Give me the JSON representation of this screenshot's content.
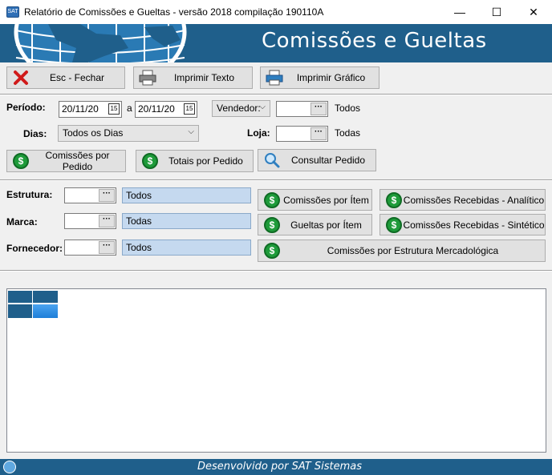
{
  "window": {
    "title": "Relatório de Comissões e Gueltas - versão 2018 compilação 190110A",
    "minimize": "—",
    "maximize": "☐",
    "close": "✕"
  },
  "banner": {
    "title": "Comissões e Gueltas"
  },
  "toolbar": {
    "close_label": "Esc - Fechar",
    "print_text_label": "Imprimir Texto",
    "print_chart_label": "Imprimir Gráfico"
  },
  "filters": {
    "periodo_label": "Período:",
    "date_from": "20/11/20",
    "date_sep": "a",
    "date_to": "20/11/20",
    "vendedor_select": "Vendedor:",
    "vendedor_value": "",
    "vendedor_all": "Todos",
    "dias_label": "Dias:",
    "dias_value": "Todos os Dias",
    "loja_label": "Loja:",
    "loja_value": "",
    "loja_all": "Todas"
  },
  "order_buttons": {
    "commissions_by_order": "Comissões por Pedido",
    "totals_by_order": "Totais por Pedido",
    "consult_order": "Consultar Pedido"
  },
  "classification": {
    "estrutura_label": "Estrutura:",
    "estrutura_desc": "Todos",
    "marca_label": "Marca:",
    "marca_desc": "Todas",
    "fornecedor_label": "Fornecedor:",
    "fornecedor_desc": "Todos"
  },
  "report_buttons": {
    "commissions_by_item": "Comissões por Ítem",
    "received_analytic": "Comissões Recebidas - Analítico",
    "gueltas_by_item": "Gueltas por Ítem",
    "received_synthetic": "Comissões Recebidas - Sintético",
    "by_structure": "Comissões por Estrutura Mercadológica"
  },
  "footer": {
    "text": "Desenvolvido por SAT Sistemas"
  },
  "colors": {
    "banner": "#1f5f8b",
    "accent_green": "#1e9b3a",
    "desc_fill": "#c5d9ef"
  }
}
